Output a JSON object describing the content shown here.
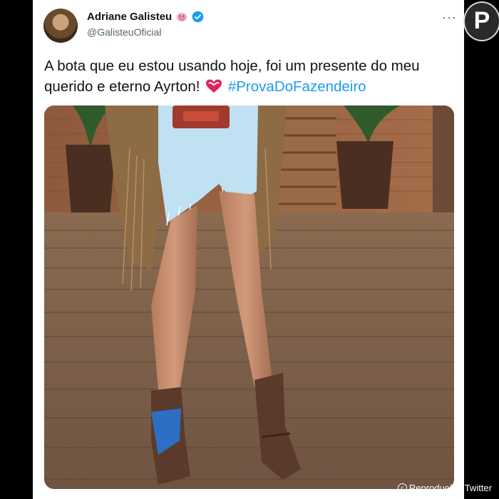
{
  "tweet": {
    "author_name": "Adriane Galisteu",
    "handle": "@GalisteuOficial",
    "text_part1": "A bota que eu estou usando hoje, foi um presente do meu querido e eterno Ayrton!",
    "hashtag": "#ProvaDoFazendeiro",
    "more_label": "···"
  },
  "icons": {
    "author_emoji": "cow-face-icon",
    "verified": "verified-badge-icon",
    "heart": "heart-icon",
    "more": "more-options-icon"
  },
  "colors": {
    "hashtag": "#1d9bf0",
    "verified": "#1d9bf0",
    "heart": "#e0245e"
  },
  "credit": {
    "text": "Reprodução, Twitter",
    "symbol": "c"
  },
  "watermark": {
    "letter": "P"
  }
}
